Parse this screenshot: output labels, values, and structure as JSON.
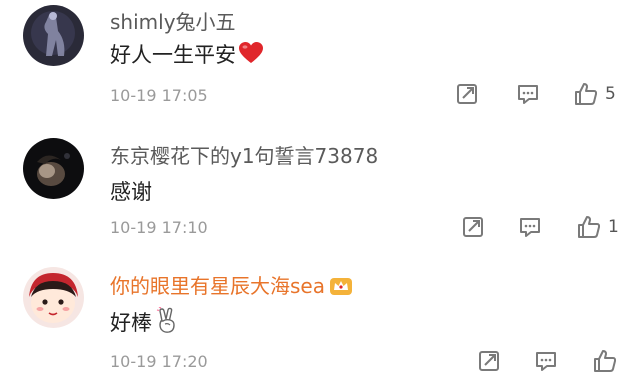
{
  "comments": [
    {
      "username": "shimly兔小五",
      "text": "好人一生平安",
      "emoji": "heart-icon",
      "time": "10-19 17:05",
      "likes": "5"
    },
    {
      "username": "东京樱花下的y1句誓言73878",
      "text": "感谢",
      "time": "10-19 17:10",
      "likes": "1"
    },
    {
      "username": "你的眼里有星辰大海sea",
      "badge": "crown-icon",
      "text": "好棒",
      "emoji": "peace-hand-icon",
      "time": "10-19 17:20",
      "likes": ""
    }
  ],
  "colors": {
    "username": "#5a5a5a",
    "vip_username": "#e8742a",
    "heart": "#e0262b",
    "icon": "#7a7a7a"
  }
}
